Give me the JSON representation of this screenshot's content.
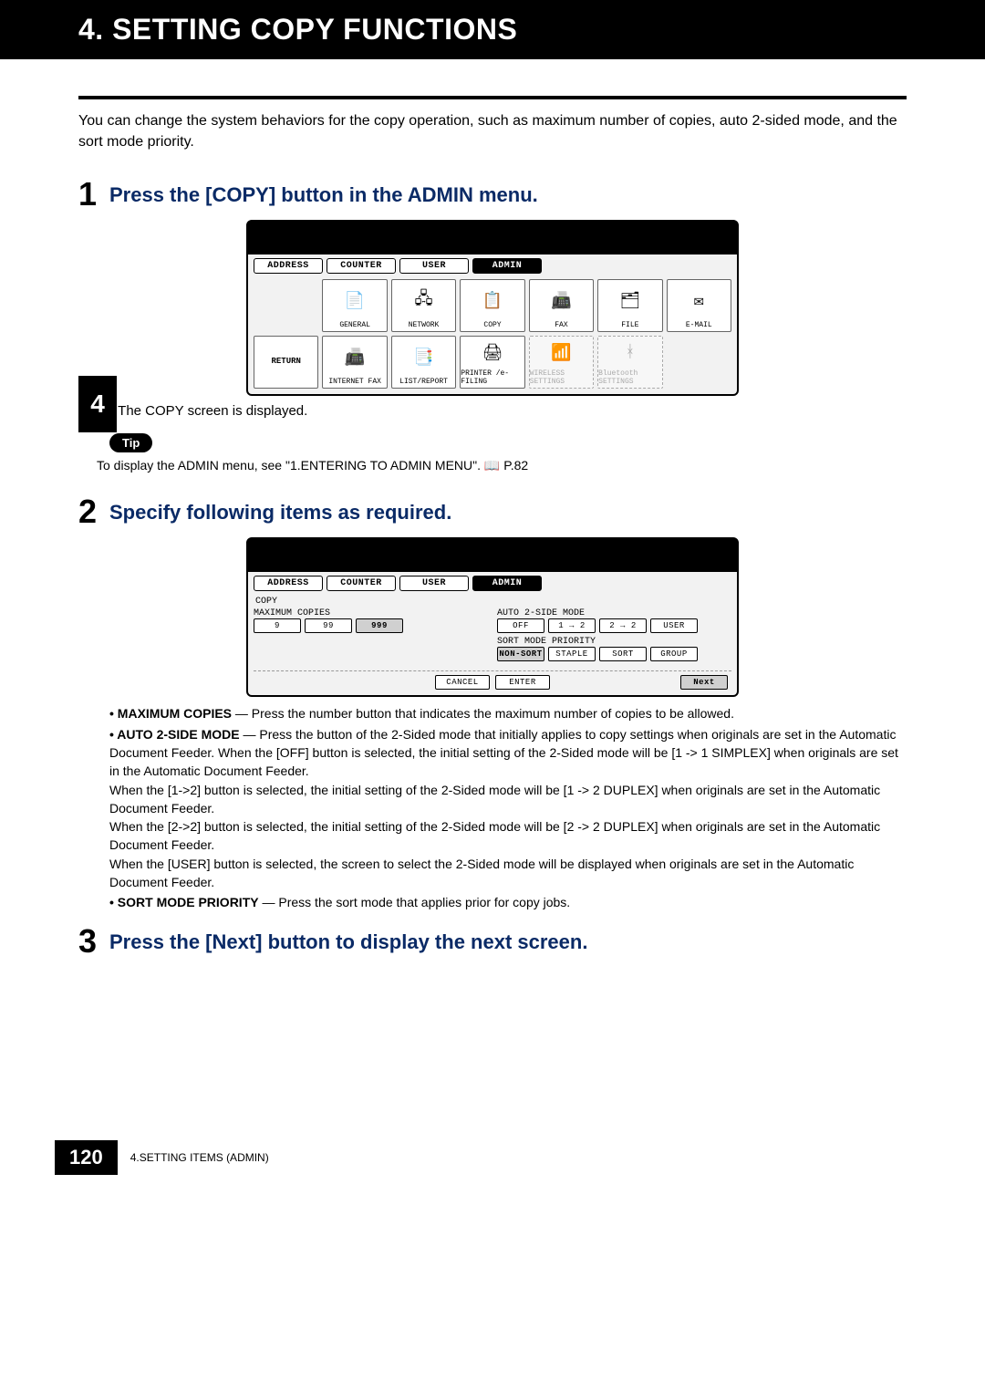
{
  "header": {
    "title": "4. SETTING COPY FUNCTIONS"
  },
  "intro": "You can change the system behaviors for the copy operation, such as maximum number of copies, auto 2-sided mode, and the sort mode priority.",
  "chapter_tab": "4",
  "steps": {
    "s1": {
      "num": "1",
      "title": "Press the [COPY] button in the ADMIN menu.",
      "post_note": "The COPY screen is displayed.",
      "tip_badge": "Tip",
      "tip_text_prefix": "To display the ADMIN menu, see \"1.ENTERING TO ADMIN MENU\".  ",
      "tip_text_pageref": "P.82"
    },
    "s2": {
      "num": "2",
      "title": "Specify following items as required.",
      "desc": {
        "max_label": "MAXIMUM COPIES",
        "max_text": " — Press the number button that indicates the maximum number of copies to be allowed.",
        "auto_label": "AUTO 2-SIDE MODE",
        "auto_text": " — Press the button of the 2-Sided mode that initially applies to copy settings when originals are set in the Automatic Document Feeder.  When the [OFF] button is selected, the initial setting of the 2-Sided mode will be [1 -> 1 SIMPLEX] when originals are set in the Automatic Document Feeder.\nWhen the [1->2] button is selected, the initial setting of the 2-Sided mode will be [1 -> 2 DUPLEX] when originals are set in the Automatic Document Feeder.\nWhen the [2->2] button is selected, the initial setting of the 2-Sided mode will be [2 -> 2 DUPLEX] when originals are set in the Automatic Document Feeder.\nWhen the [USER] button is selected, the screen to select the 2-Sided mode will be displayed when originals are set in the Automatic Document Feeder.",
        "sort_label": "SORT MODE PRIORITY",
        "sort_text": " — Press the sort mode that applies prior for copy jobs."
      }
    },
    "s3": {
      "num": "3",
      "title": "Press the [Next] button to display the next screen."
    }
  },
  "screen1": {
    "tabs": [
      "ADDRESS",
      "COUNTER",
      "USER",
      "ADMIN"
    ],
    "active_tab": 3,
    "row1": [
      "",
      "GENERAL",
      "NETWORK",
      "COPY",
      "FAX",
      "FILE",
      "E-MAIL"
    ],
    "row1_icons": [
      "",
      "📄",
      "🖧",
      "📋",
      "📠",
      "🗂",
      "✉"
    ],
    "row2": [
      "RETURN",
      "INTERNET FAX",
      "LIST/REPORT",
      "PRINTER /e-FILING",
      "WIRELESS SETTINGS",
      "Bluetooth SETTINGS",
      ""
    ],
    "row2_icons": [
      "",
      "📠",
      "📑",
      "🖨",
      "📶",
      "ᚼ",
      ""
    ],
    "row2_disabled": [
      false,
      false,
      false,
      false,
      true,
      true,
      false
    ]
  },
  "screen2": {
    "tabs": [
      "ADDRESS",
      "COUNTER",
      "USER",
      "ADMIN"
    ],
    "active_tab": 3,
    "subtitle": "COPY",
    "left_label": "MAXIMUM COPIES",
    "max_options": [
      "9",
      "99",
      "999"
    ],
    "right_a_label": "AUTO 2-SIDE MODE",
    "auto_options": [
      "OFF",
      "1 → 2",
      "2 → 2",
      "USER"
    ],
    "right_b_label": "SORT MODE PRIORITY",
    "sort_options": [
      "NON-SORT",
      "STAPLE",
      "SORT",
      "GROUP"
    ],
    "bottom": {
      "cancel": "CANCEL",
      "enter": "ENTER",
      "next": "Next"
    }
  },
  "footer": {
    "page": "120",
    "label": "4.SETTING ITEMS (ADMIN)"
  }
}
